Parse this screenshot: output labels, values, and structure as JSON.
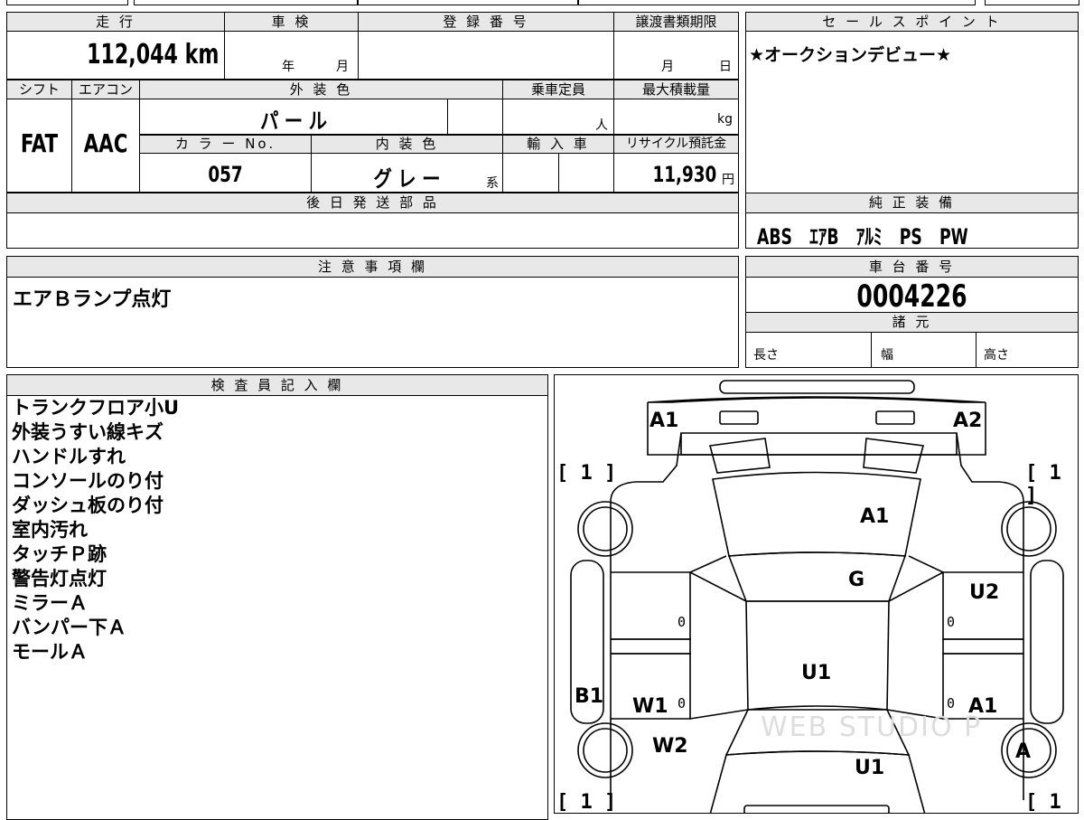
{
  "top_left": {
    "mileage_header": "走 行",
    "mileage_value": "112,044 km",
    "inspection_header": "車 検",
    "inspection_year": "年",
    "inspection_month": "月",
    "registration_header": "登 録 番 号",
    "transfer_header": "譲渡書類期限",
    "transfer_month": "月",
    "transfer_day": "日",
    "shift_header": "シフト",
    "shift_value": "FAT",
    "ac_header": "エアコン",
    "ac_value": "AAC",
    "exterior_color_header": "外 装 色",
    "exterior_color_value": "パ ー ル",
    "capacity_header": "乗車定員",
    "capacity_unit": "人",
    "max_load_header": "最大積載量",
    "max_load_unit": "kg",
    "color_no_header": "カ ラ ー No.",
    "color_no_value": "057",
    "interior_color_header": "内 装 色",
    "interior_color_value": "グ レ ー",
    "interior_color_suffix": "系",
    "import_header": "輸 入 車",
    "recycle_header": "リサイクル預託金",
    "recycle_value": "11,930",
    "recycle_unit": "円",
    "later_parts_header": "後 日 発 送 部 品"
  },
  "sales_point": {
    "header": "セ ー ル ス ポ イ ン ト",
    "text": "★オークションデビュー★"
  },
  "genuine_equipment": {
    "header": "純 正 装 備",
    "text": "ABS　ｴｱB　ｱﾙﾐ　PS　PW"
  },
  "notes": {
    "header": "注 意 事 項 欄",
    "text": "エアＢランプ点灯"
  },
  "chassis": {
    "header": "車 台 番 号",
    "value": "0004226",
    "spec_header": "諸 元",
    "length_label": "長さ",
    "width_label": "幅",
    "height_label": "高さ"
  },
  "inspector": {
    "header": "検 査 員 記 入 欄",
    "lines": [
      "トランクフロア小U",
      "外装うすい線キズ",
      "ハンドルすれ",
      "コンソールのり付",
      "ダッシュ板のり付",
      "室内汚れ",
      "タッチＰ跡",
      "警告灯点灯",
      "ミラーＡ",
      "バンパー下Ａ",
      "モールＡ"
    ]
  },
  "diagram": {
    "marks": {
      "a1_rear_left": "A1",
      "a2_rear_right": "A2",
      "a1_trunk": "A1",
      "g_rear_glass": "G",
      "u2_right": "U2",
      "u1_roof": "U1",
      "b1_left_pillar": "B1",
      "w1_left": "W1",
      "a1_right": "A1",
      "w2_left": "W2",
      "a_right_wheel": "A",
      "u1_hood": "U1"
    },
    "bracket_values": [
      "1",
      "1",
      "1",
      "1"
    ],
    "zero_values": [
      "0",
      "0",
      "0",
      "0"
    ],
    "watermark": "WEB STUDIO P"
  }
}
